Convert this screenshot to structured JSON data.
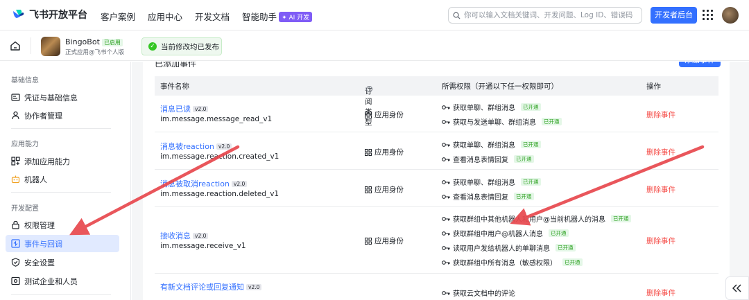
{
  "header": {
    "logo_text": "飞书开放平台",
    "nav": [
      "客户案例",
      "应用中心",
      "开发文档",
      "智能助手"
    ],
    "ai_badge": "✦ AI 开发",
    "search_placeholder": "你可以输入文档关键词、开发问题、Log ID、错误码",
    "dev_console_label": "开发者后台"
  },
  "app": {
    "name": "BingoBot",
    "status_badge": "已启用",
    "subtitle": "正式应用@飞书个人版",
    "toast": "当前修改均已发布"
  },
  "sidebar": {
    "groups": [
      {
        "title": "基础信息",
        "items": [
          {
            "label": "凭证与基础信息",
            "icon": "credential-icon"
          },
          {
            "label": "协作者管理",
            "icon": "user-icon"
          }
        ]
      },
      {
        "title": "应用能力",
        "items": [
          {
            "label": "添加应用能力",
            "icon": "add-capability-icon"
          },
          {
            "label": "机器人",
            "icon": "robot-icon"
          }
        ]
      },
      {
        "title": "开发配置",
        "items": [
          {
            "label": "权限管理",
            "icon": "lock-icon"
          },
          {
            "label": "事件与回调",
            "icon": "event-icon",
            "active": true
          },
          {
            "label": "安全设置",
            "icon": "shield-icon"
          },
          {
            "label": "测试企业和人员",
            "icon": "test-icon"
          }
        ]
      }
    ]
  },
  "events": {
    "section_title": "已添加事件",
    "add_button": "添加事件",
    "columns": [
      "事件名称",
      "订阅类型",
      "所需权限（开通以下任一权限即可）",
      "操作"
    ],
    "rows": [
      {
        "name": "消息已读",
        "version": "v2.0",
        "code": "im.message.message_read_v1",
        "sub_type": "应用身份",
        "perms": [
          {
            "label": "获取单聊、群组消息",
            "status": "已开通"
          },
          {
            "label": "获取与发送单聊、群组消息",
            "status": "已开通"
          }
        ],
        "action": "删除事件"
      },
      {
        "name": "消息被reaction",
        "version": "v2.0",
        "code": "im.message.reaction.created_v1",
        "sub_type": "应用身份",
        "perms": [
          {
            "label": "获取单聊、群组消息",
            "status": "已开通"
          },
          {
            "label": "查看消息表情回复",
            "status": "已开通"
          }
        ],
        "action": "删除事件"
      },
      {
        "name": "消息被取消reaction",
        "version": "v2.0",
        "code": "im.message.reaction.deleted_v1",
        "sub_type": "应用身份",
        "perms": [
          {
            "label": "获取单聊、群组消息",
            "status": "已开通"
          },
          {
            "label": "查看消息表情回复",
            "status": "已开通"
          }
        ],
        "action": "删除事件"
      },
      {
        "name": "接收消息",
        "version": "v2.0",
        "code": "im.message.receive_v1",
        "sub_type": "应用身份",
        "perms": [
          {
            "label": "获取群组中其他机器人和用户@当前机器人的消息",
            "status": "已开通"
          },
          {
            "label": "获取群组中用户@机器人消息",
            "status": "已开通"
          },
          {
            "label": "读取用户发给机器人的单聊消息",
            "status": "已开通"
          },
          {
            "label": "获取群组中所有消息（敏感权限）",
            "status": "已开通"
          }
        ],
        "action": "删除事件"
      },
      {
        "name": "有新文档评论或回复通知",
        "version": "v2.0",
        "code": "",
        "sub_type": "",
        "perms": [
          {
            "label": "获取云文档中的评论",
            "status": ""
          }
        ],
        "action": "删除事件"
      }
    ]
  },
  "colors": {
    "accent": "#3370ff",
    "danger": "#f54a45",
    "success": "#2ea121",
    "arrow": "#e8484e"
  }
}
